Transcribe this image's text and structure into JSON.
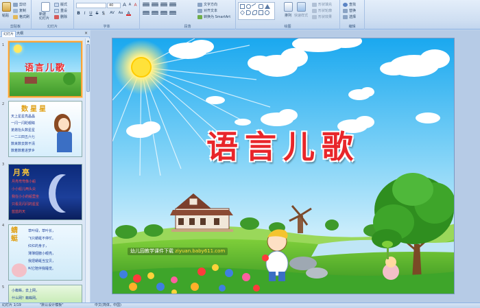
{
  "ribbon": {
    "clipboard": {
      "paste": "粘贴",
      "cut": "剪切",
      "copy": "复制",
      "format_painter": "格式刷",
      "label": "剪贴板"
    },
    "slides": {
      "new_slide": "新建\n幻灯片",
      "layout": "版式",
      "reset": "重设",
      "delete": "删除",
      "label": "幻灯片"
    },
    "font": {
      "font_name": "",
      "font_size": "40",
      "grow": "A",
      "shrink": "A",
      "clear": "A",
      "bold": "B",
      "italic": "I",
      "underline": "U",
      "strike": "S",
      "shadow": "S",
      "spacing": "AV",
      "case": "Aa",
      "color": "A",
      "label": "字体"
    },
    "paragraph": {
      "text_direction": "文字方向",
      "align_text": "对齐文本",
      "smartart": "转换为 SmartArt",
      "label": "段落"
    },
    "drawing": {
      "arrange": "排列",
      "quick_styles": "快速样式",
      "shape_fill": "形状填充",
      "shape_outline": "形状轮廓",
      "shape_effects": "形状效果",
      "label": "绘图"
    },
    "editing": {
      "find": "查找",
      "replace": "替换",
      "select": "选择",
      "label": "编辑"
    }
  },
  "side_panel": {
    "tabs": [
      "幻灯片",
      "大纲"
    ],
    "close": "×",
    "thumbnails": [
      {
        "num": "1",
        "title": "语言儿歌"
      },
      {
        "num": "2",
        "title": "数星星",
        "lines": [
          "天上星星亮晶晶",
          "一闪一闪眨眼睛",
          "弟弟抬头数星星",
          "一二三四五六七",
          "数来数去数不清",
          "数着数着进梦乡"
        ]
      },
      {
        "num": "3",
        "title": "月亮",
        "lines": [
          "月亮弯弯像小船",
          "小小船儿两头尖",
          "我在小小的船里坐",
          "只看见闪闪的星星",
          "蓝蓝的天"
        ]
      },
      {
        "num": "4",
        "title": "蜻蜓",
        "lines": [
          "草叶绿，草叶长，",
          "飞只蜻蜓不停忙。",
          "红红的身子，",
          "薄薄翅膀小眼亮，",
          "我把蜻蜓当宝贝，",
          "叫它陪伴我睡觉。"
        ]
      },
      {
        "num": "5",
        "lines": [
          "小蜘蛛，去上网，",
          "什么网？蜘蛛网。"
        ]
      }
    ]
  },
  "slide": {
    "title": "语言儿歌",
    "banner_prefix": "幼儿园教学课件下载",
    "banner_url": "ziyuan.baby611.com"
  },
  "status_bar": {
    "slide_pos": "幻灯片 1/19",
    "theme": "\"默认设计模板\"",
    "language": "中文(简体，中国)"
  },
  "colors": {
    "ribbon_bg": "#dbe7f5",
    "title_red": "#e8262a",
    "accent_orange": "#f7a23a"
  }
}
